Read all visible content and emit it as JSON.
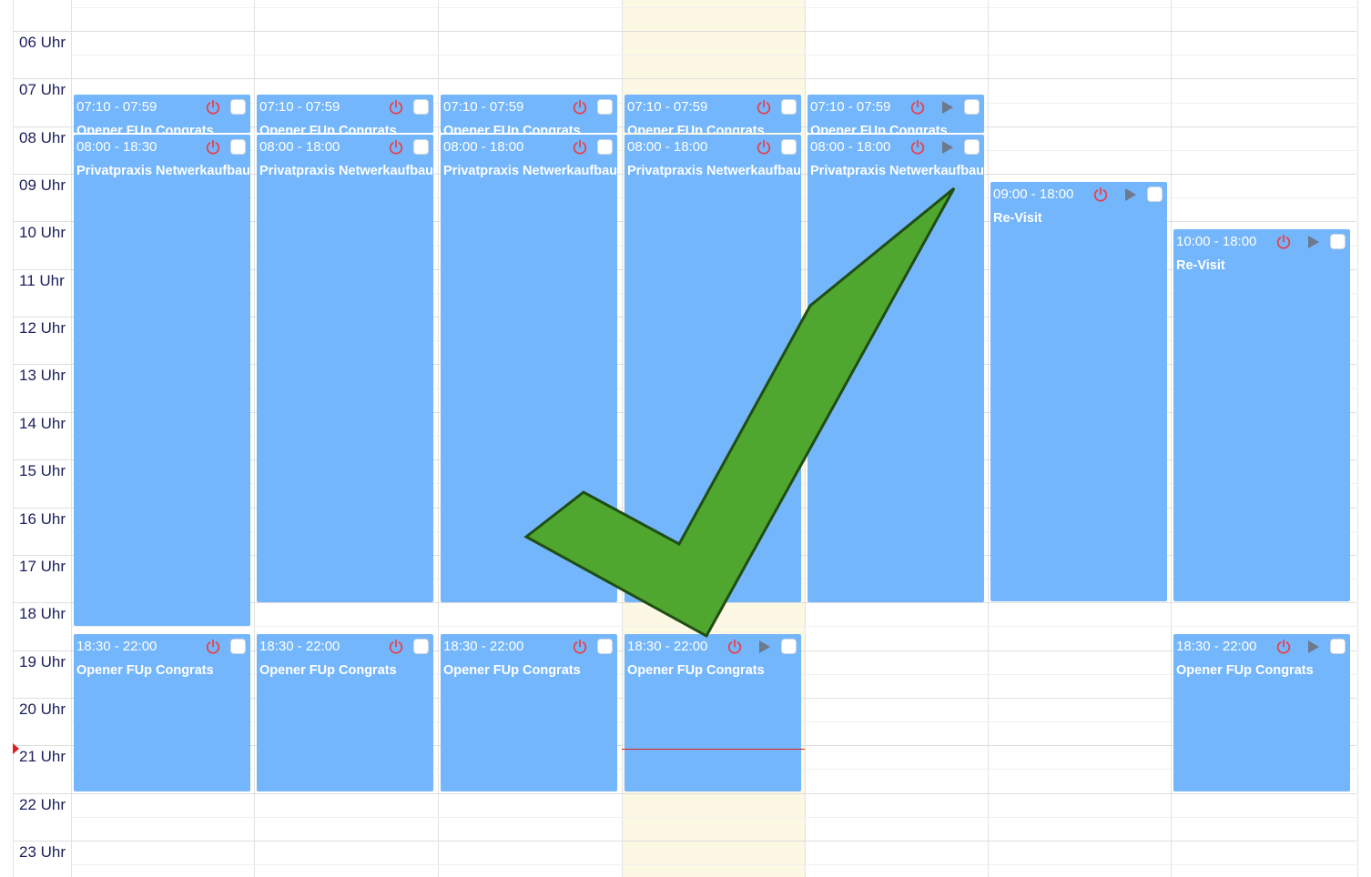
{
  "hours": [
    "06 Uhr",
    "07 Uhr",
    "08 Uhr",
    "09 Uhr",
    "10 Uhr",
    "11 Uhr",
    "12 Uhr",
    "13 Uhr",
    "14 Uhr",
    "15 Uhr",
    "16 Uhr",
    "17 Uhr",
    "18 Uhr",
    "19 Uhr",
    "20 Uhr",
    "21 Uhr",
    "22 Uhr",
    "23 Uhr"
  ],
  "events": [
    {
      "day": 0,
      "time": "07:10 - 07:59",
      "title": "Opener FUp Congrats",
      "play": false
    },
    {
      "day": 1,
      "time": "07:10 - 07:59",
      "title": "Opener FUp Congrats",
      "play": false
    },
    {
      "day": 2,
      "time": "07:10 - 07:59",
      "title": "Opener FUp Congrats",
      "play": false
    },
    {
      "day": 3,
      "time": "07:10 - 07:59",
      "title": "Opener FUp Congrats",
      "play": false
    },
    {
      "day": 4,
      "time": "07:10 - 07:59",
      "title": "Opener FUp Congrats",
      "play": true
    },
    {
      "day": 0,
      "time": "08:00 - 18:30",
      "title": "Privatpraxis Netwerkaufbau",
      "play": false
    },
    {
      "day": 1,
      "time": "08:00 - 18:00",
      "title": "Privatpraxis Netwerkaufbau",
      "play": false
    },
    {
      "day": 2,
      "time": "08:00 - 18:00",
      "title": "Privatpraxis Netwerkaufbau",
      "play": false
    },
    {
      "day": 3,
      "time": "08:00 - 18:00",
      "title": "Privatpraxis Netwerkaufbau",
      "play": false
    },
    {
      "day": 4,
      "time": "08:00 - 18:00",
      "title": "Privatpraxis Netwerkaufbau",
      "play": true
    },
    {
      "day": 5,
      "time": "09:00 - 18:00",
      "title": "Re-Visit",
      "play": true
    },
    {
      "day": 6,
      "time": "10:00 - 18:00",
      "title": "Re-Visit",
      "play": true
    },
    {
      "day": 0,
      "time": "18:30 - 22:00",
      "title": "Opener FUp Congrats",
      "play": false
    },
    {
      "day": 1,
      "time": "18:30 - 22:00",
      "title": "Opener FUp Congrats",
      "play": false
    },
    {
      "day": 2,
      "time": "18:30 - 22:00",
      "title": "Opener FUp Congrats",
      "play": false
    },
    {
      "day": 3,
      "time": "18:30 - 22:00",
      "title": "Opener FUp Congrats",
      "play": true
    },
    {
      "day": 6,
      "time": "18:30 - 22:00",
      "title": "Opener FUp Congrats",
      "play": true
    }
  ],
  "colors": {
    "event_bg": "#74b6fb",
    "today_bg": "#fcf8e3",
    "power_icon": "#e8404a",
    "play_icon": "#6b7a8c",
    "checkmark_fill": "#4fa72f",
    "checkmark_stroke": "#1f4d12",
    "now_line": "#e02020"
  }
}
